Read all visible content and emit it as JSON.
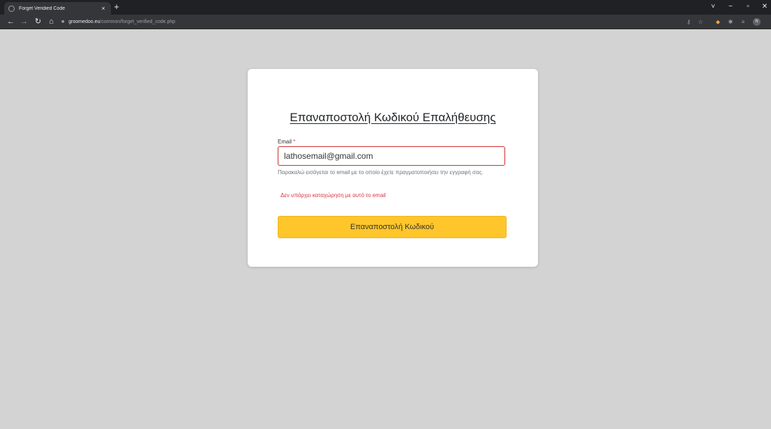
{
  "browser": {
    "tab_title": "Forget Veridied Code",
    "tab_close": "×",
    "new_tab": "+",
    "url_host": "groomedoo.eu",
    "url_path": "/common/forget_verified_code.php",
    "profile_initial": "N",
    "window_controls": [
      "˅",
      "−",
      "▫",
      "✕"
    ]
  },
  "form": {
    "title": "Επαναποστολή Κωδικού Επαλήθευσης",
    "email_label": "Email",
    "required_mark": "*",
    "email_value": "lathosemail@gmail.com",
    "help_text": "Παρακαλώ εισάγεται το email με το οποίο έχετε πραγματοποιήσει την εγγραφή σας.",
    "error_text": "Δεν υπάρχει καταχώρηση με αυτό το email",
    "submit_label": "Επαναποστολή Κωδικού",
    "error_color": "#dc3545",
    "button_color": "#ffc62b"
  }
}
